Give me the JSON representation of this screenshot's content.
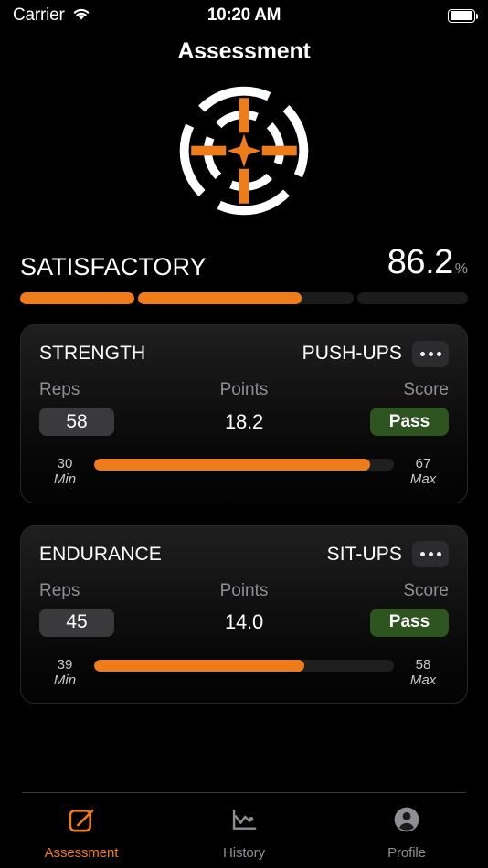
{
  "status_bar": {
    "carrier": "Carrier",
    "time": "10:20 AM",
    "wifi_icon": "wifi-icon",
    "battery_icon": "battery-full-icon"
  },
  "header": {
    "title": "Assessment",
    "emblem_icon": "target-crosshair-icon"
  },
  "summary": {
    "rating_label": "SATISFACTORY",
    "score_value": "86.2",
    "score_unit": "%",
    "segments": [
      {
        "fill_percent": 100
      },
      {
        "fill_percent": 76
      },
      {
        "fill_percent": 0
      }
    ]
  },
  "colors": {
    "accent_orange": "#ef7c1b",
    "pass_green": "#2e5520",
    "background": "#000000",
    "card_top": "#1f1f1f",
    "muted_text": "#8e8e93",
    "track": "#1f1f1f"
  },
  "cards": [
    {
      "title": "STRENGTH",
      "subtitle": "PUSH-UPS",
      "more_button": "•••",
      "columns": {
        "reps": "Reps",
        "points": "Points",
        "score": "Score"
      },
      "reps_value": "58",
      "points_value": "18.2",
      "score_value": "Pass",
      "range": {
        "min_value": "30",
        "min_caption": "Min",
        "max_value": "67",
        "max_caption": "Max",
        "fill_percent": 92
      }
    },
    {
      "title": "ENDURANCE",
      "subtitle": "SIT-UPS",
      "more_button": "•••",
      "columns": {
        "reps": "Reps",
        "points": "Points",
        "score": "Score"
      },
      "reps_value": "45",
      "points_value": "14.0",
      "score_value": "Pass",
      "range": {
        "min_value": "39",
        "min_caption": "Min",
        "max_value": "58",
        "max_caption": "Max",
        "fill_percent": 70
      }
    }
  ],
  "tabbar": {
    "items": [
      {
        "label": "Assessment",
        "icon": "square-pencil-icon",
        "active": true
      },
      {
        "label": "History",
        "icon": "line-chart-icon",
        "active": false
      },
      {
        "label": "Profile",
        "icon": "person-circle-icon",
        "active": false
      }
    ]
  }
}
